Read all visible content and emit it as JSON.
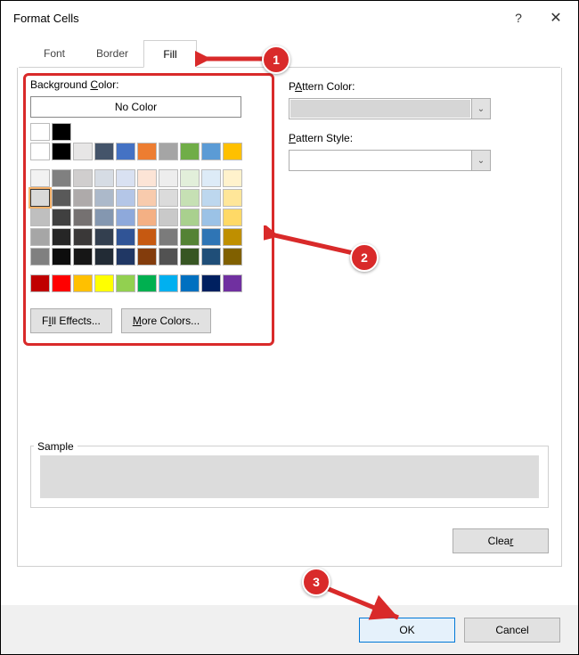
{
  "dialog": {
    "title": "Format Cells",
    "help": "?",
    "close": "✕"
  },
  "tabs": {
    "font": "Font",
    "border": "Border",
    "fill": "Fill"
  },
  "fill": {
    "bgcolor_label": "Background Color:",
    "bgcolor_underline": "C",
    "no_color": "No Color",
    "fill_effects": "Fill Effects...",
    "fill_effects_underline": "I",
    "more_colors": "More Colors...",
    "more_colors_underline": "M",
    "pattern_color_label": "Pattern Color:",
    "pattern_color_underline": "A",
    "pattern_style_label": "Pattern Style:",
    "pattern_style_underline": "P",
    "sample_label": "Sample",
    "clear": "Clear",
    "clear_underline": "r"
  },
  "buttons": {
    "ok": "OK",
    "cancel": "Cancel"
  },
  "annotations": {
    "b1": "1",
    "b2": "2",
    "b3": "3"
  },
  "palette": {
    "row0": [
      "#ffffff",
      "#000000"
    ],
    "row1": [
      "#ffffff",
      "#000000",
      "#e7e6e6",
      "#44546a",
      "#4472c4",
      "#ed7d31",
      "#a5a5a5",
      "#70ad47",
      "#5b9bd5",
      "#ffc000"
    ],
    "row2": [
      "#f2f2f2",
      "#808080",
      "#d0cece",
      "#d6dce4",
      "#d9e1f2",
      "#fce4d6",
      "#ededed",
      "#e2efda",
      "#ddebf7",
      "#fff2cc"
    ],
    "row3": [
      "#d9d9d9",
      "#595959",
      "#aeaaaa",
      "#acb9ca",
      "#b4c6e7",
      "#f8cbad",
      "#dbdbdb",
      "#c6e0b4",
      "#bdd7ee",
      "#ffe699"
    ],
    "row4": [
      "#bfbfbf",
      "#404040",
      "#757171",
      "#8497b0",
      "#8ea9db",
      "#f4b084",
      "#c9c9c9",
      "#a9d08e",
      "#9bc2e6",
      "#ffd966"
    ],
    "row5": [
      "#a6a6a6",
      "#262626",
      "#3a3838",
      "#333f4f",
      "#305496",
      "#c65911",
      "#7b7b7b",
      "#548235",
      "#2f75b5",
      "#bf8f00"
    ],
    "row6": [
      "#808080",
      "#0d0d0d",
      "#161616",
      "#222b35",
      "#203764",
      "#833c0c",
      "#525252",
      "#375623",
      "#1f4e78",
      "#806000"
    ],
    "row7": [
      "#c00000",
      "#ff0000",
      "#ffc000",
      "#ffff00",
      "#92d050",
      "#00b050",
      "#00b0f0",
      "#0070c0",
      "#002060",
      "#7030a0"
    ]
  }
}
